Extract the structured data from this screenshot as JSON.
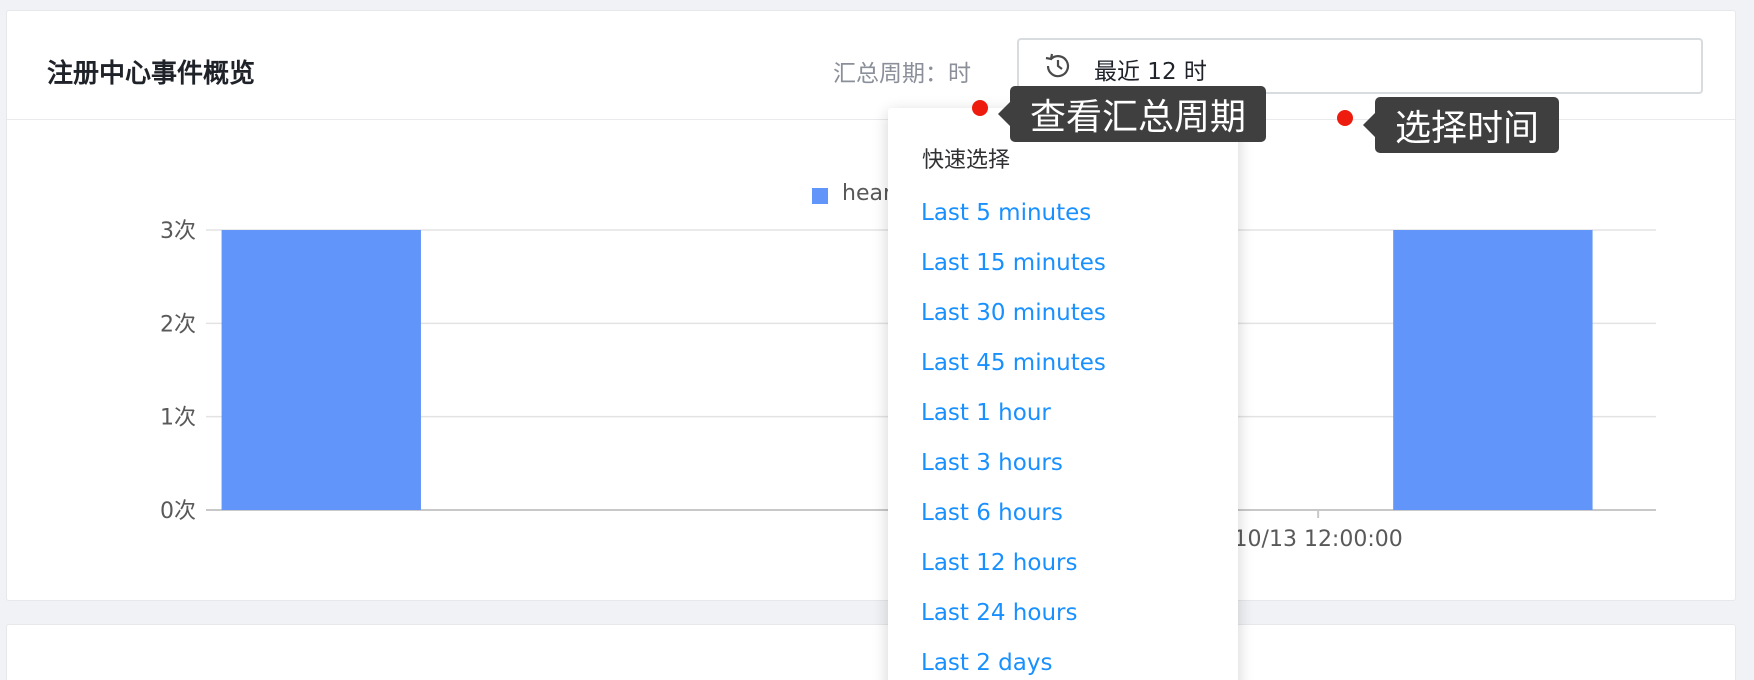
{
  "header": {
    "title": "注册中心事件概览",
    "period_label": "汇总周期：时"
  },
  "time_picker": {
    "value": "最近 12 时",
    "icon": "history-clock-icon"
  },
  "dropdown": {
    "heading": "快速选择",
    "items": [
      "Last 5 minutes",
      "Last 15 minutes",
      "Last 30 minutes",
      "Last 45 minutes",
      "Last 1 hour",
      "Last 3 hours",
      "Last 6 hours",
      "Last 12 hours",
      "Last 24 hours",
      "Last 2 days"
    ]
  },
  "annotations": {
    "view_period": "查看汇总周期",
    "select_time": "选择时间",
    "color": "#ee1c0e"
  },
  "chart_data": {
    "type": "bar",
    "series": [
      {
        "name": "heart",
        "color": "#6295f9",
        "x_positions": [
          0.0795,
          0.8875
        ],
        "values": [
          3,
          3
        ]
      }
    ],
    "visible_x_tick_labels": [
      "10/13 12:00:00"
    ],
    "visible_x_tick_positions": [
      0.767
    ],
    "y_ticks": [
      "0次",
      "1次",
      "2次",
      "3次"
    ],
    "ylim": [
      0,
      3
    ],
    "grid": true
  }
}
